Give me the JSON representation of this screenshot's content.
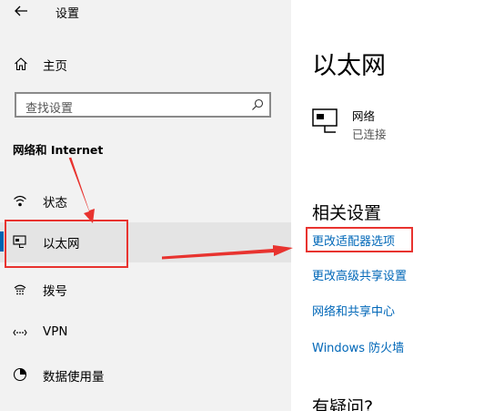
{
  "window": {
    "title": "设置"
  },
  "sidebar": {
    "home_label": "主页",
    "search_placeholder": "查找设置",
    "section_heading": "网络和 Internet",
    "items": [
      {
        "label": "状态",
        "icon": "status-icon"
      },
      {
        "label": "以太网",
        "icon": "ethernet-icon",
        "selected": true
      },
      {
        "label": "拨号",
        "icon": "dialup-icon"
      },
      {
        "label": "VPN",
        "icon": "vpn-icon"
      },
      {
        "label": "数据使用量",
        "icon": "data-usage-icon"
      }
    ]
  },
  "main": {
    "title": "以太网",
    "network": {
      "name": "网络",
      "status": "已连接",
      "icon": "ethernet-icon"
    },
    "related_heading": "相关设置",
    "links": [
      "更改适配器选项",
      "更改高级共享设置",
      "网络和共享中心",
      "Windows 防火墙"
    ],
    "help_heading": "有疑问?"
  },
  "annotations": {
    "highlight_color": "#e8332f",
    "accent": "#0063b1",
    "link_color": "#0067b8"
  }
}
